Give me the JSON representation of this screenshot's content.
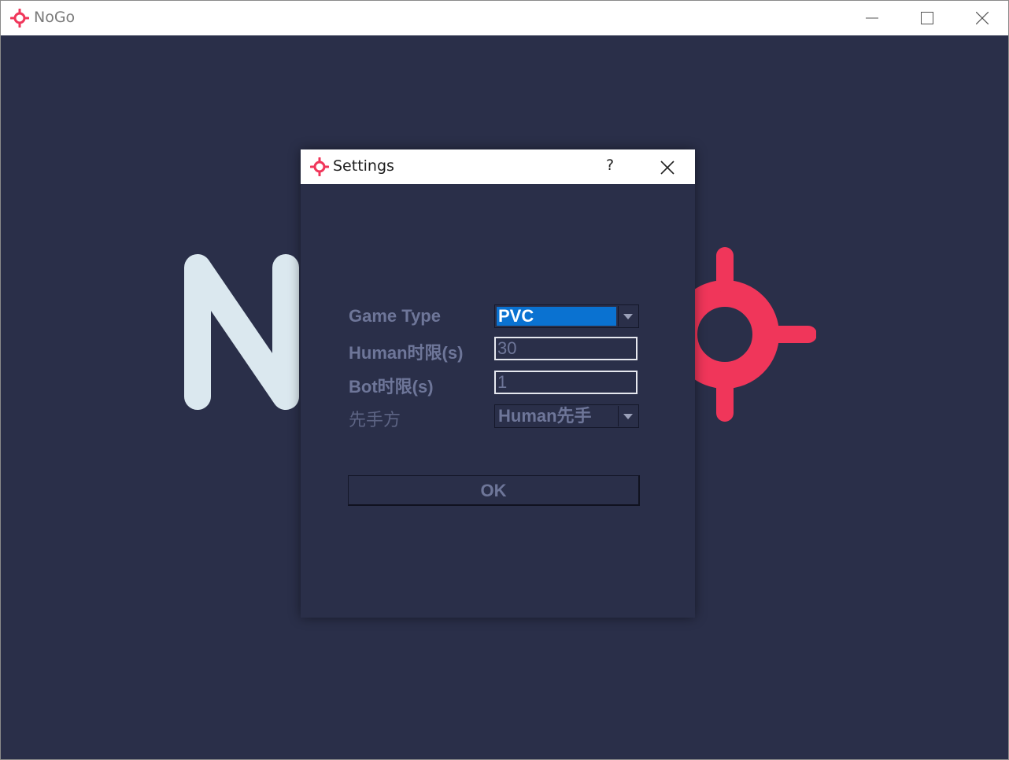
{
  "window": {
    "title": "NoGo",
    "minimize_icon": "minimize-icon",
    "maximize_icon": "maximize-icon",
    "close_icon": "close-icon"
  },
  "background_logo": {
    "letter": "N",
    "letter_color": "#dbe8ef",
    "mark_color": "#f0365a",
    "icon": "crosshair-logo-icon"
  },
  "colors": {
    "client_bg": "#2a2f49",
    "accent": "#f0365a",
    "selection": "#0a72d1",
    "label": "#6e7699"
  },
  "dialog": {
    "title": "Settings",
    "help_label": "?",
    "close_icon": "close-icon",
    "fields": {
      "game_type": {
        "label": "Game Type",
        "value": "PVC"
      },
      "human_limit": {
        "label": "Human时限(s)",
        "value": "30"
      },
      "bot_limit": {
        "label": "Bot时限(s)",
        "value": "1"
      },
      "first_player": {
        "label": "先手方",
        "value": "Human先手"
      }
    },
    "ok_label": "OK"
  }
}
